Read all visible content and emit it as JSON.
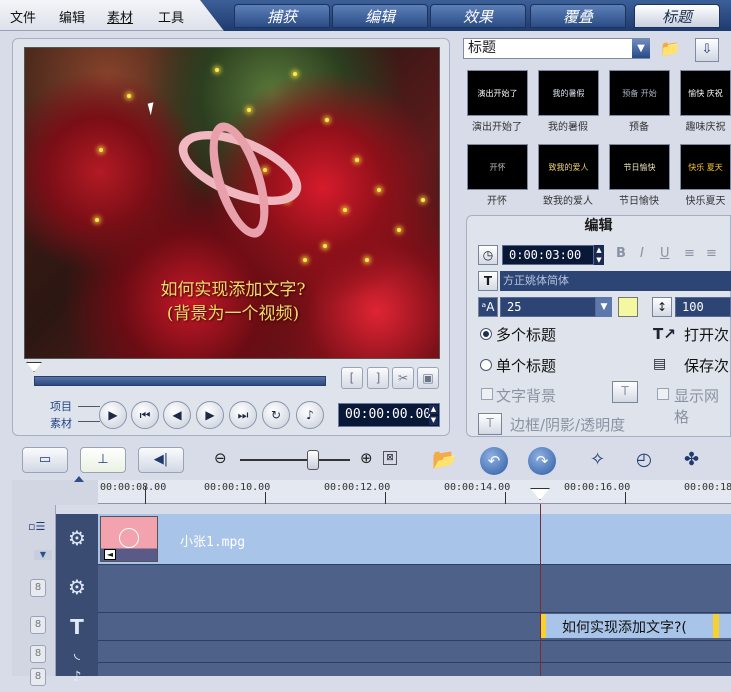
{
  "menu": [
    "文件",
    "编辑",
    "素材",
    "工具"
  ],
  "tabs": [
    "捕获",
    "编辑",
    "效果",
    "覆叠",
    "标题"
  ],
  "preview": {
    "caption_line1": "如何实现添加文字?",
    "caption_line2": "(背景为一个视频)",
    "mode_project": "项目",
    "mode_clip": "素材",
    "timecode": "00:00:00.00",
    "trim_start": "[",
    "trim_end": "]"
  },
  "title_panel": {
    "category": "标题",
    "thumbnails": [
      {
        "thumb_text": "演出开始了",
        "label": "演出开始了"
      },
      {
        "thumb_text": "我的暑假",
        "label": "我的暑假"
      },
      {
        "thumb_text": "预备 开始",
        "label": "预备"
      },
      {
        "thumb_text": "愉快 庆祝",
        "label": "趣味庆祝"
      },
      {
        "thumb_text": "开怀",
        "label": "开怀"
      },
      {
        "thumb_text": "致我的爱人",
        "label": "致我的爱人"
      },
      {
        "thumb_text": "节日愉快",
        "label": "节日愉快"
      },
      {
        "thumb_text": "快乐 夏天",
        "label": "快乐夏天"
      }
    ]
  },
  "edit_panel": {
    "header": "编辑",
    "duration": "0:00:03:00",
    "font_name": "方正姚体简体",
    "font_size": "25",
    "line_spacing": "100",
    "multi_title": "多个标题",
    "single_title": "单个标题",
    "text_background": "文字背景",
    "open_title": "打开次",
    "save_title": "保存次",
    "show_grid": "显示网格",
    "border_shadow": "边框/阴影/透明度",
    "text_color": "#f4f8a0"
  },
  "timeline": {
    "ticks": [
      "00:00:08.00",
      "00:00:10.00",
      "00:00:12.00",
      "00:00:14.00",
      "00:00:16.00",
      "00:00:18"
    ],
    "video_clip": "小张1.mpg",
    "title_clip": "如何实现添加文字?("
  },
  "colors": {
    "accent": "#1f3b6e",
    "track": "#a8c4e8",
    "clip_thumb": "#f2a3ad"
  }
}
